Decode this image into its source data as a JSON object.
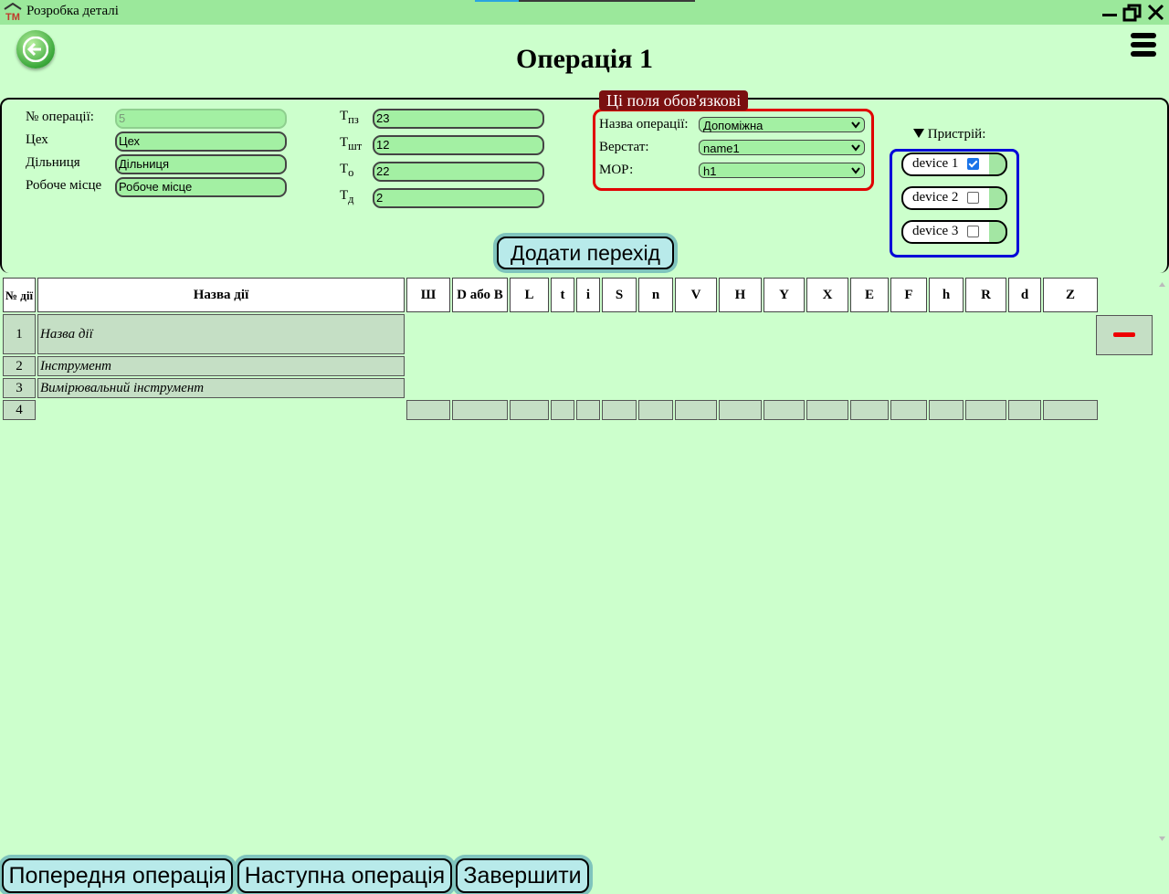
{
  "window": {
    "title": "Розробка деталі",
    "app_icon": "ТМ"
  },
  "page": {
    "title": "Операція 1"
  },
  "fields": {
    "op_number": {
      "label": "№ операції:",
      "value": "5"
    },
    "workshop": {
      "label": "Цех",
      "value": "Цех"
    },
    "section": {
      "label": "Дільниця",
      "value": "Дільниця"
    },
    "workplace": {
      "label": "Робоче місце",
      "value": "Робоче місце"
    }
  },
  "times": [
    {
      "sym": "Т",
      "sub": "пз",
      "value": "23"
    },
    {
      "sym": "Т",
      "sub": "шт",
      "value": "12"
    },
    {
      "sym": "Т",
      "sub": "о",
      "value": "22"
    },
    {
      "sym": "Т",
      "sub": "д",
      "value": "2"
    }
  ],
  "required": {
    "title": "Ці поля обов'язкові",
    "op_name": {
      "label": "Назва операції:",
      "value": "Допоміжна"
    },
    "machine": {
      "label": "Верстат:",
      "value": "name1"
    },
    "mor": {
      "label": "МОР:",
      "value": "h1"
    }
  },
  "devices": {
    "summary": "Пристрій:",
    "items": [
      {
        "label": "device 1",
        "checked": true
      },
      {
        "label": "device 2",
        "checked": false
      },
      {
        "label": "device 3",
        "checked": false
      }
    ]
  },
  "add_transition": "Додати перехід",
  "table": {
    "num_header": "№ дії",
    "name_header": "Назва дії",
    "param_headers": [
      "Ш",
      "D або B",
      "L",
      "t",
      "i",
      "S",
      "n",
      "V",
      "H",
      "Y",
      "X",
      "E",
      "F",
      "h",
      "R",
      "d",
      "Z"
    ],
    "rows": [
      {
        "num": "1",
        "name": "Назва дії"
      },
      {
        "num": "2",
        "name": "Інструмент"
      },
      {
        "num": "3",
        "name": "Вимірювальний інструмент"
      },
      {
        "num": "4",
        "name": ""
      }
    ]
  },
  "bottom": {
    "prev": "Попередня операція",
    "next": "Наступна операція",
    "finish": "Завершити"
  },
  "colors": {
    "background": "#ccffcc",
    "titlebar": "#9be89b",
    "required_border": "#e00000",
    "device_border": "#0000d8",
    "required_title_bg": "#7a1010"
  }
}
